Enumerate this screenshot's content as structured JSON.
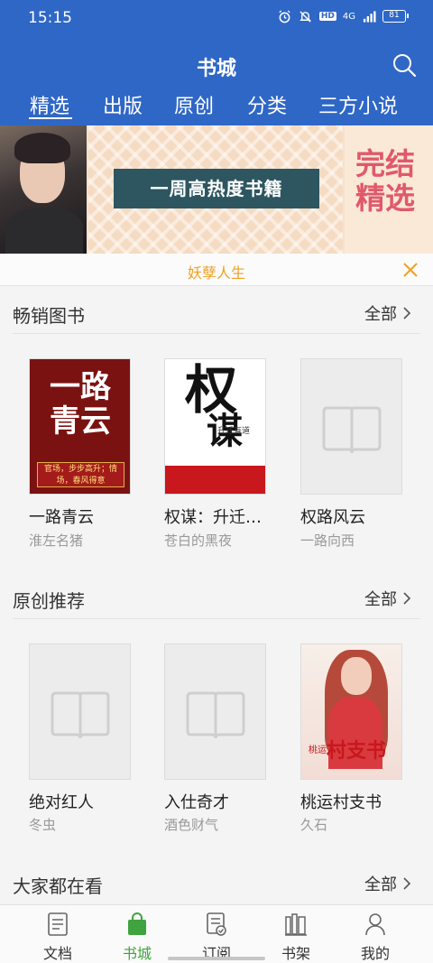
{
  "status_bar": {
    "time": "15:15",
    "hd": "HD",
    "signal": "4G",
    "battery": "81"
  },
  "header": {
    "title": "书城",
    "search_icon": "search-icon",
    "tabs": [
      {
        "label": "精选",
        "active": true
      },
      {
        "label": "出版",
        "active": false
      },
      {
        "label": "原创",
        "active": false
      },
      {
        "label": "分类",
        "active": false
      },
      {
        "label": "三方小说",
        "active": false
      }
    ]
  },
  "banner": {
    "center_text": "一周高热度书籍",
    "right_text": "完结精选"
  },
  "notice": {
    "text": "妖孽人生",
    "close_icon": "close-icon"
  },
  "sections": [
    {
      "title": "畅销图书",
      "more": "全部",
      "books": [
        {
          "title": "一路青云",
          "author": "淮左名猪",
          "cover": "cover-image",
          "cover_text": "一路青云",
          "cover_band": "官场，步步高升；情场，春风得意"
        },
        {
          "title": "权谋：升迁…",
          "author": "苍白的黑夜",
          "cover": "cover-image",
          "cover_text_1": "权",
          "cover_text_2": "谋",
          "cover_side": "升迁有道"
        },
        {
          "title": "权路风云",
          "author": "一路向西",
          "cover": "placeholder"
        }
      ]
    },
    {
      "title": "原创推荐",
      "more": "全部",
      "books": [
        {
          "title": "绝对红人",
          "author": "冬虫",
          "cover": "placeholder"
        },
        {
          "title": "入仕奇才",
          "author": "酒色财气",
          "cover": "placeholder"
        },
        {
          "title": "桃运村支书",
          "author": "久石",
          "cover": "cover-image",
          "cover_text": "村支书",
          "cover_small": "桃运"
        }
      ]
    },
    {
      "title": "大家都在看",
      "more": "全部"
    }
  ],
  "bottom_nav": [
    {
      "label": "文档",
      "icon": "document-icon",
      "active": false
    },
    {
      "label": "书城",
      "icon": "shopping-bag-icon",
      "active": true
    },
    {
      "label": "订阅",
      "icon": "subscription-icon",
      "active": false
    },
    {
      "label": "书架",
      "icon": "bookshelf-icon",
      "active": false
    },
    {
      "label": "我的",
      "icon": "person-icon",
      "active": false
    }
  ],
  "colors": {
    "primary": "#2f67c6",
    "accent_active": "#3fa33f",
    "notice": "#f0a024"
  }
}
